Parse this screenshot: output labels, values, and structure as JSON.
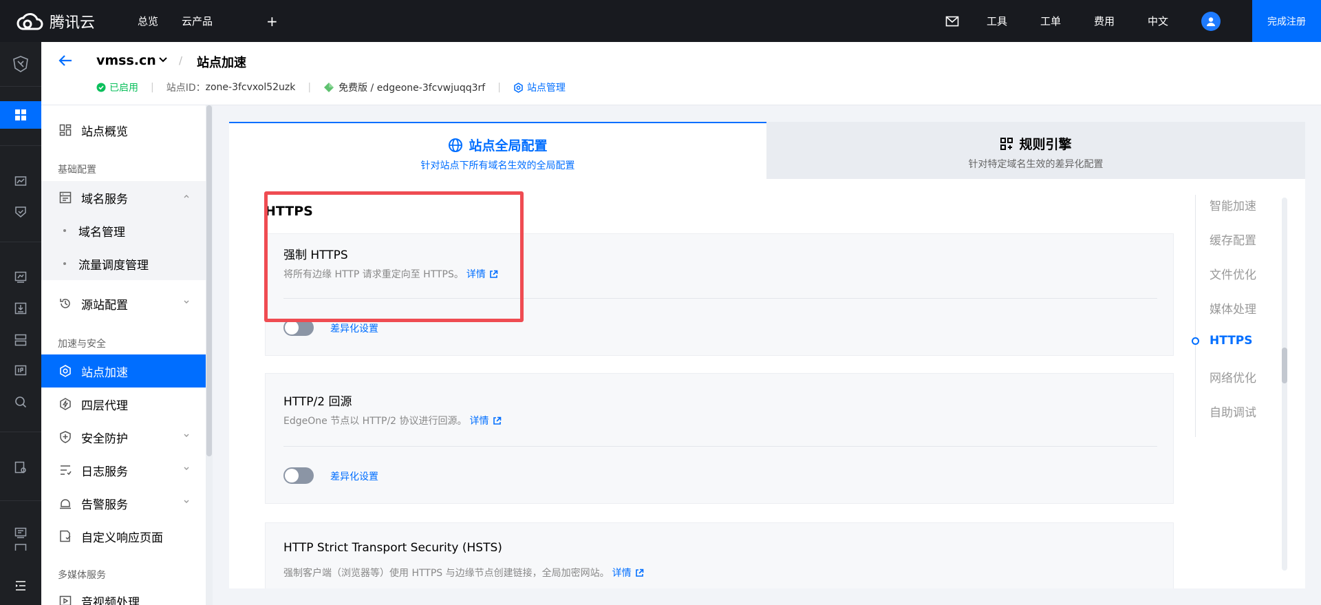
{
  "topbar": {
    "brand": "腾讯云",
    "nav": [
      "总览",
      "云产品"
    ],
    "plus": "+",
    "right_items": [
      "工具",
      "工单",
      "费用",
      "中文"
    ],
    "register": "完成注册"
  },
  "header": {
    "site_name": "vmss.cn",
    "separator": "/",
    "page_title": "站点加速",
    "status": "已启用",
    "zone_label": "站点ID：",
    "zone_id": "zone-3fcvxol52uzk",
    "plan": "免费版 / edgeone-3fcvwjuqq3rf",
    "manage": "站点管理"
  },
  "sidebar": {
    "overview": "站点概览",
    "group_basic": "基础配置",
    "domain_service": "域名服务",
    "domain_manage": "域名管理",
    "traffic_manage": "流量调度管理",
    "origin_config": "源站配置",
    "group_security": "加速与安全",
    "site_accel": "站点加速",
    "l4_proxy": "四层代理",
    "security": "安全防护",
    "log_service": "日志服务",
    "alarm_service": "告警服务",
    "custom_page": "自定义响应页面",
    "group_media": "多媒体服务",
    "av_process": "音视频处理"
  },
  "tabs": {
    "global_title": "站点全局配置",
    "global_sub": "针对站点下所有域名生效的全局配置",
    "rules_title": "规则引擎",
    "rules_sub": "针对特定域名生效的差异化配置"
  },
  "section": {
    "title": "HTTPS"
  },
  "cards": {
    "force_https": {
      "title": "强制 HTTPS",
      "desc": "将所有边缘 HTTP 请求重定向至 HTTPS。",
      "detail": "详情",
      "toggle_label": "差异化设置",
      "enabled": false
    },
    "http2": {
      "title": "HTTP/2 回源",
      "desc": "EdgeOne 节点以 HTTP/2 协议进行回源。",
      "detail": "详情",
      "toggle_label": "差异化设置",
      "enabled": false
    },
    "hsts": {
      "title": "HTTP Strict Transport Security (HSTS)",
      "desc": "强制客户端（浏览器等）使用 HTTPS 与边缘节点创建链接，全局加密网站。",
      "detail": "详情"
    }
  },
  "anchor_nav": [
    "智能加速",
    "缓存配置",
    "文件优化",
    "媒体处理",
    "HTTPS",
    "网络优化",
    "自助调试"
  ],
  "colors": {
    "primary": "#006eff",
    "topbar": "#181a1f",
    "success": "#0abf5b",
    "highlight": "#ef4c52"
  }
}
